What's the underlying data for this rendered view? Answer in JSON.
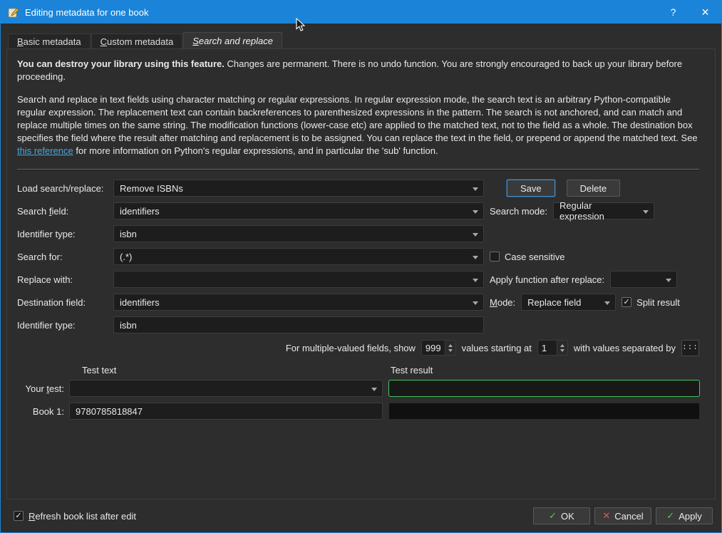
{
  "window": {
    "title": "Editing metadata for one book",
    "help_icon": "?",
    "close_icon": "✕"
  },
  "tabs": [
    {
      "u": "B",
      "rest": "asic metadata"
    },
    {
      "u": "C",
      "rest": "ustom metadata"
    },
    {
      "u": "S",
      "rest": "earch and replace"
    }
  ],
  "intro": {
    "warning_bold": "You can destroy your library using this feature.",
    "warning_rest": " Changes are permanent. There is no undo function. You are strongly encouraged to back up your library before proceeding.",
    "desc_before_link": "Search and replace in text fields using character matching or regular expressions. In regular expression mode, the search text is an arbitrary Python-compatible regular expression. The replacement text can contain backreferences to parenthesized expressions in the pattern. The search is not anchored, and can match and replace multiple times on the same string. The modification functions (lower-case etc) are applied to the matched text, not to the field as a whole. The destination box specifies the field where the result after matching and replacement is to be assigned. You can replace the text in the field, or prepend or append the matched text. See ",
    "link_text": "this reference",
    "desc_after_link": " for more information on Python's regular expressions, and in particular the 'sub' function."
  },
  "form": {
    "load_label": "Load search/replace:",
    "load_value": "Remove ISBNs",
    "save_label": "Save",
    "delete_label": "Delete",
    "search_field_label_pre": "Search ",
    "search_field_label_u": "f",
    "search_field_label_post": "ield:",
    "search_field_value": "identifiers",
    "search_mode_label": "Search mode:",
    "search_mode_value": "Regular expression",
    "identifier_type_label": "Identifier type:",
    "identifier_type_value": "isbn",
    "search_for_label": "Search for:",
    "search_for_value": "(.*)",
    "case_sensitive_label": "Case sensitive",
    "replace_with_label": "Replace with:",
    "replace_with_value": "",
    "apply_function_label": "Apply function after replace:",
    "apply_function_value": "",
    "destination_field_label": "Destination field:",
    "destination_field_value": "identifiers",
    "mode_label_u": "M",
    "mode_label_post": "ode:",
    "mode_value": "Replace field",
    "split_result_label": "Split result",
    "identifier_type2_label": "Identifier type:",
    "identifier_type2_value": "isbn",
    "multi_show_label": "For multiple-valued fields, show",
    "multi_show_value": "999",
    "multi_start_label": "values starting at",
    "multi_start_value": "1",
    "multi_sep_label": "with values separated by",
    "multi_sep_button": ":::"
  },
  "test": {
    "text_header": "Test text",
    "result_header": "Test result",
    "your_test_label_pre": "Your ",
    "your_test_label_u": "t",
    "your_test_label_post": "est:",
    "your_test_value": "",
    "your_test_result": "",
    "book1_label": "Book 1:",
    "book1_value": "9780785818847",
    "book1_result": ""
  },
  "footer": {
    "refresh_u": "R",
    "refresh_rest": "efresh book list after edit",
    "ok_label": "OK",
    "cancel_label": "Cancel",
    "apply_label": "Apply",
    "ok_icon": "✓",
    "cancel_icon": "✕",
    "apply_icon": "✓"
  },
  "icons": {
    "check": "✓"
  },
  "colors": {
    "titlebar": "#1b84d8",
    "panel_bg": "#2d2d2d",
    "input_bg": "#1d1d1d",
    "link": "#4aa6e0",
    "save_border": "#3f8fd2",
    "result_border": "#47c45e",
    "ok_green": "#53c761",
    "cancel_red": "#e05555"
  }
}
